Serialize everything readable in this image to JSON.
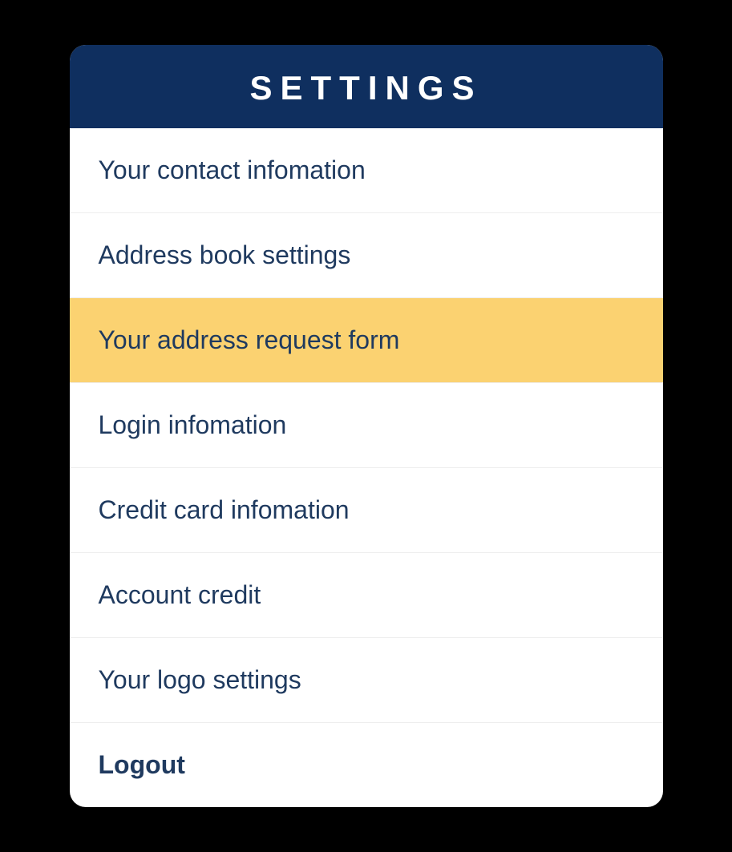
{
  "header": {
    "title": "SETTINGS"
  },
  "menu": {
    "items": [
      {
        "label": "Your contact infomation",
        "selected": false,
        "bold": false
      },
      {
        "label": "Address book settings",
        "selected": false,
        "bold": false
      },
      {
        "label": "Your address request form",
        "selected": true,
        "bold": false
      },
      {
        "label": "Login infomation",
        "selected": false,
        "bold": false
      },
      {
        "label": "Credit card infomation",
        "selected": false,
        "bold": false
      },
      {
        "label": "Account credit",
        "selected": false,
        "bold": false
      },
      {
        "label": "Your logo settings",
        "selected": false,
        "bold": false
      },
      {
        "label": "Logout",
        "selected": false,
        "bold": true
      }
    ]
  },
  "colors": {
    "headerBg": "#0f2f5f",
    "selectedBg": "#fbd271",
    "textColor": "#1f3a5f"
  }
}
